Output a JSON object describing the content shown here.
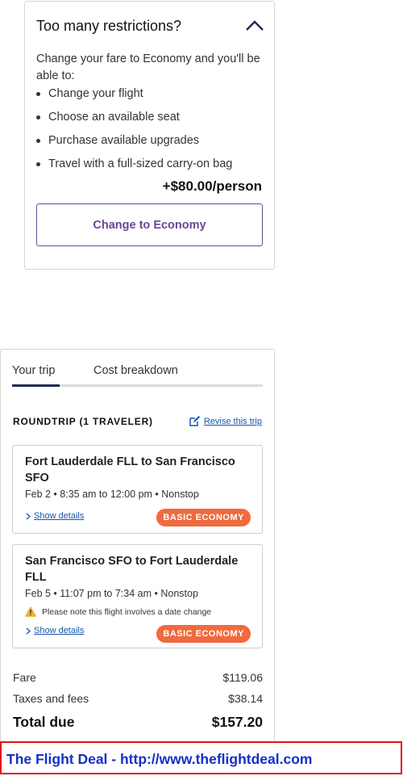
{
  "restrictions": {
    "title": "Too many restrictions?",
    "description": "Change your fare to Economy and you'll be able to:",
    "benefits": [
      "Change your flight",
      "Choose an available seat",
      "Purchase available upgrades",
      "Travel with a full-sized carry-on bag"
    ],
    "price": "+$80.00/person",
    "button_label": "Change to Economy",
    "expand_icon": "chevron-up-icon"
  },
  "trip": {
    "tabs": [
      "Your trip",
      "Cost breakdown"
    ],
    "active_tab": "Your trip",
    "heading": "ROUNDTRIP (1 TRAVELER)",
    "revise_label": "Revise this trip",
    "revise_icon": "edit-icon",
    "legs": [
      {
        "route": "Fort Lauderdale FLL to San Francisco SFO",
        "time": "Feb 2 • 8:35 am to 12:00 pm • Nonstop",
        "details_label": "Show details",
        "badge": "BASIC ECONOMY"
      },
      {
        "route": "San Francisco SFO to Fort Lauderdale FLL",
        "time": "Feb 5 • 11:07 pm to 7:34 am • Nonstop",
        "note": "Please note this flight involves a date change",
        "note_icon": "warning-icon",
        "details_label": "Show details",
        "badge": "BASIC ECONOMY"
      }
    ],
    "costs": {
      "fare_label": "Fare",
      "fare_value": "$119.06",
      "taxes_label": "Taxes and fees",
      "taxes_value": "$38.14",
      "total_label": "Total due",
      "total_value": "$157.20"
    }
  },
  "banner": {
    "text": "The Flight Deal - http://www.theflightdeal.com"
  },
  "colors": {
    "accent_purple": "#6a4596",
    "badge_orange": "#f06a3e",
    "tab_indicator": "#1d2b58",
    "link_blue": "#1a56a8",
    "banner_border": "#e5121b",
    "banner_text": "#1430c8"
  }
}
